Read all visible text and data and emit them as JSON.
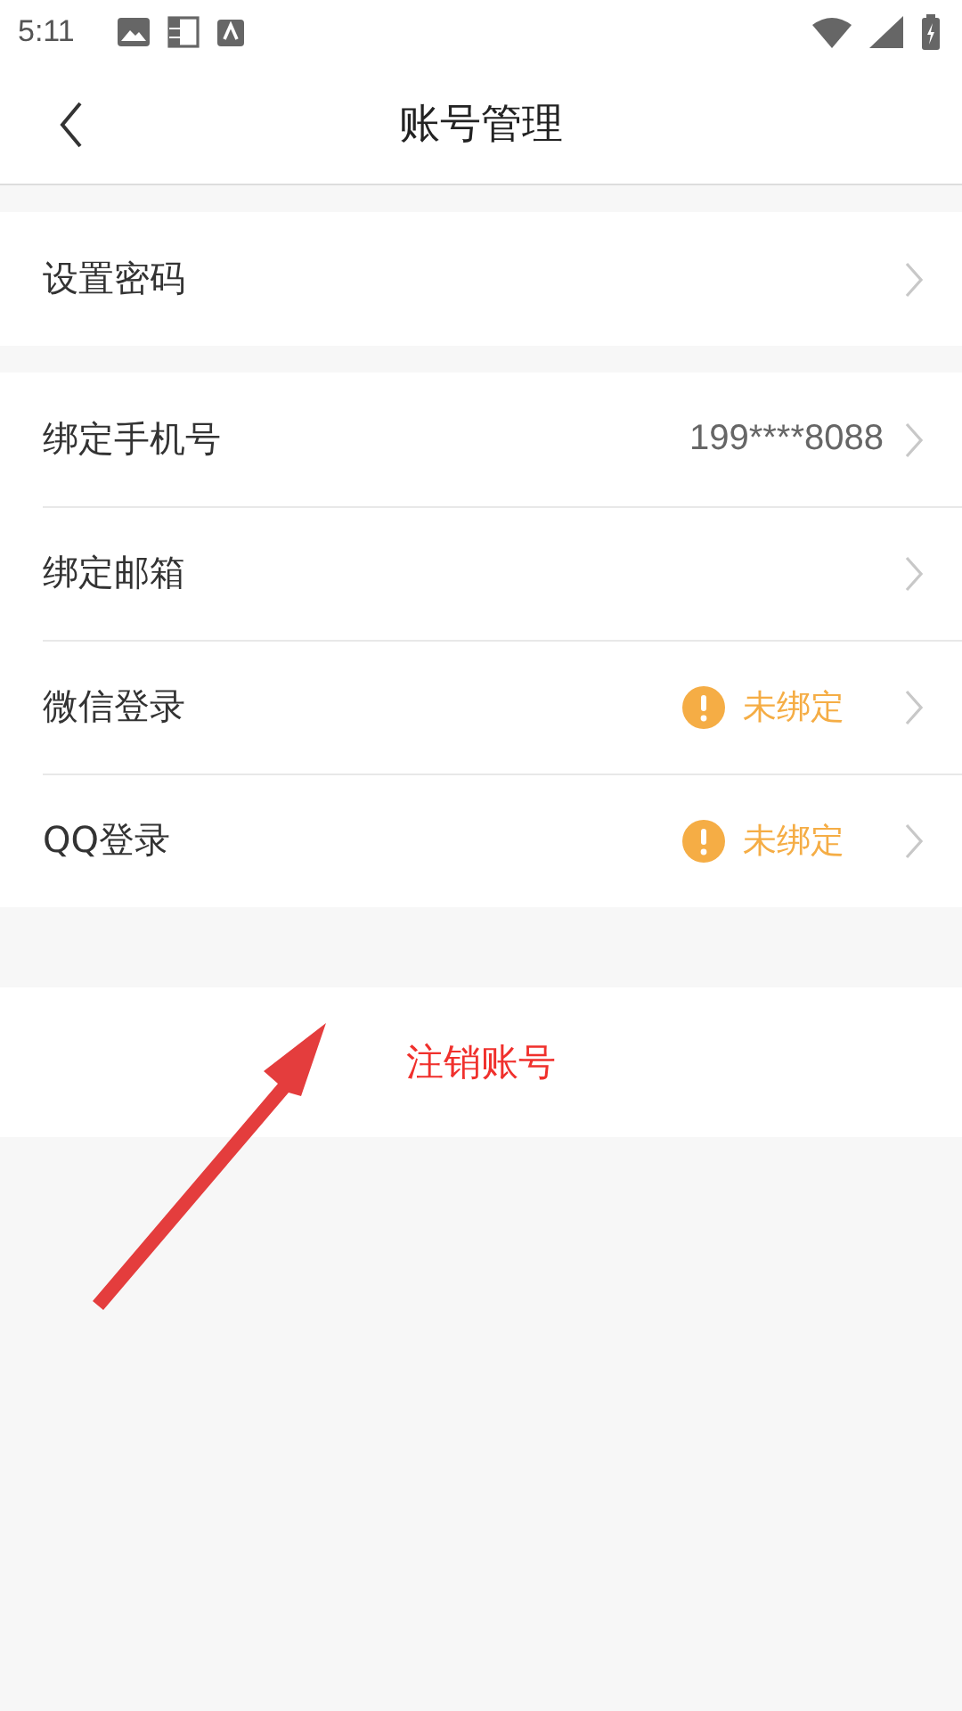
{
  "status_bar": {
    "time": "5:11"
  },
  "header": {
    "title": "账号管理"
  },
  "groups": [
    {
      "rows": [
        {
          "label": "设置密码",
          "kind": "link"
        }
      ]
    },
    {
      "rows": [
        {
          "label": "绑定手机号",
          "kind": "value",
          "value": "199****8088"
        },
        {
          "label": "绑定邮箱",
          "kind": "link"
        },
        {
          "label": "微信登录",
          "kind": "warning",
          "value": "未绑定"
        },
        {
          "label": "QQ登录",
          "kind": "warning",
          "value": "未绑定"
        }
      ]
    }
  ],
  "delete_button": {
    "label": "注销账号"
  }
}
